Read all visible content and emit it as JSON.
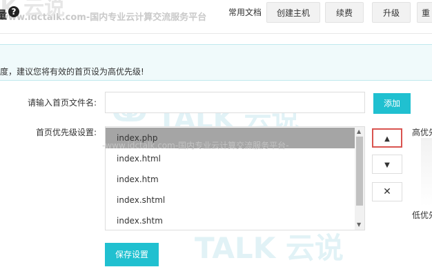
{
  "header": {
    "title_fragment": "量",
    "help_glyph": "?",
    "docs_label": "常用文档",
    "buttons": [
      "创建主机",
      "续费",
      "升级",
      "重"
    ]
  },
  "watermark": {
    "site_text": "www.idctalk.com-国内专业云计算交流服务平台",
    "site_text_mid": "-www.idctalk.com-国内专业云计算交流服务平台-",
    "logo_text": "TALK 云说",
    "logo_top_fragment": "TALK 云说"
  },
  "notice": {
    "text": "度，建议您将有效的首页设为高优先级!"
  },
  "form": {
    "input_label": "请输入首页文件名:",
    "input_value": "",
    "add_label": "添加",
    "priority_label": "首页优先级设置:",
    "options": [
      "index.php",
      "index.html",
      "index.htm",
      "index.shtml",
      "index.shtm"
    ],
    "selected_option": "index.php",
    "move_up_glyph": "▲",
    "move_down_glyph": "▼",
    "delete_glyph": "✕",
    "high_priority_label": "高优先",
    "low_priority_label": "低优先",
    "save_label": "保存设置"
  },
  "colors": {
    "accent": "#20c0d0",
    "selected_option_bg": "#a5a5a5",
    "active_button_border": "#d9534f"
  }
}
